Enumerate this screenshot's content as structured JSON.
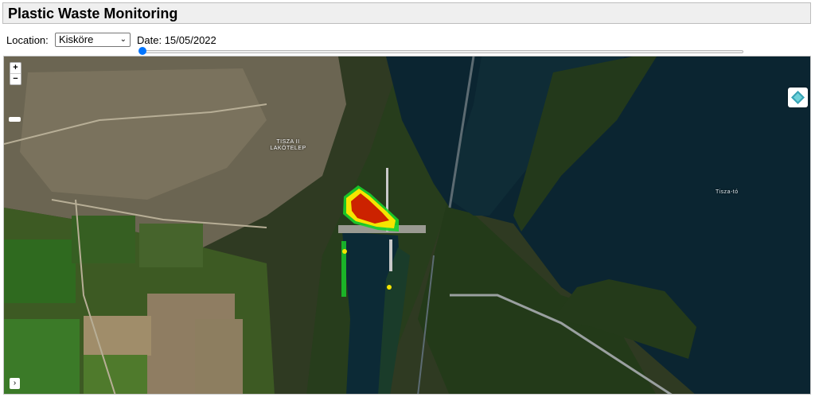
{
  "header": {
    "title": "Plastic Waste Monitoring"
  },
  "controls": {
    "location_label": "Location:",
    "location_value": "Kisköre",
    "date_label": "Date:",
    "date_value": "15/05/2022",
    "date_slider_progress": 0
  },
  "map": {
    "zoom_in": "+",
    "zoom_out": "−",
    "expand": "›",
    "labels": {
      "settlement_line1": "TISZA II",
      "settlement_line2": "LAKÓTELEP",
      "lake": "Tisza-tó"
    },
    "heat_colors": {
      "high": "#cc2200",
      "medium": "#f5e400",
      "low": "#19d12a"
    }
  }
}
